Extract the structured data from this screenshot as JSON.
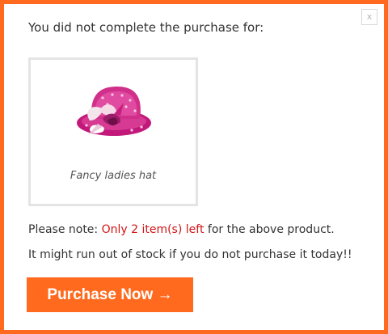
{
  "popup": {
    "close_label": "x",
    "heading": "You did not complete the purchase for:",
    "product": {
      "name": "Fancy ladies hat",
      "image_icon": "pink-hat-image"
    },
    "note_prefix": "Please note: ",
    "note_highlight": "Only 2 item(s) left",
    "note_suffix": " for the above product.",
    "warning": "It might run out of stock if you do not purchase it today!!",
    "purchase_button": "Purchase Now →"
  },
  "colors": {
    "accent": "#ff6a1f",
    "highlight_text": "#d31515",
    "card_border": "#e4e4e4"
  }
}
